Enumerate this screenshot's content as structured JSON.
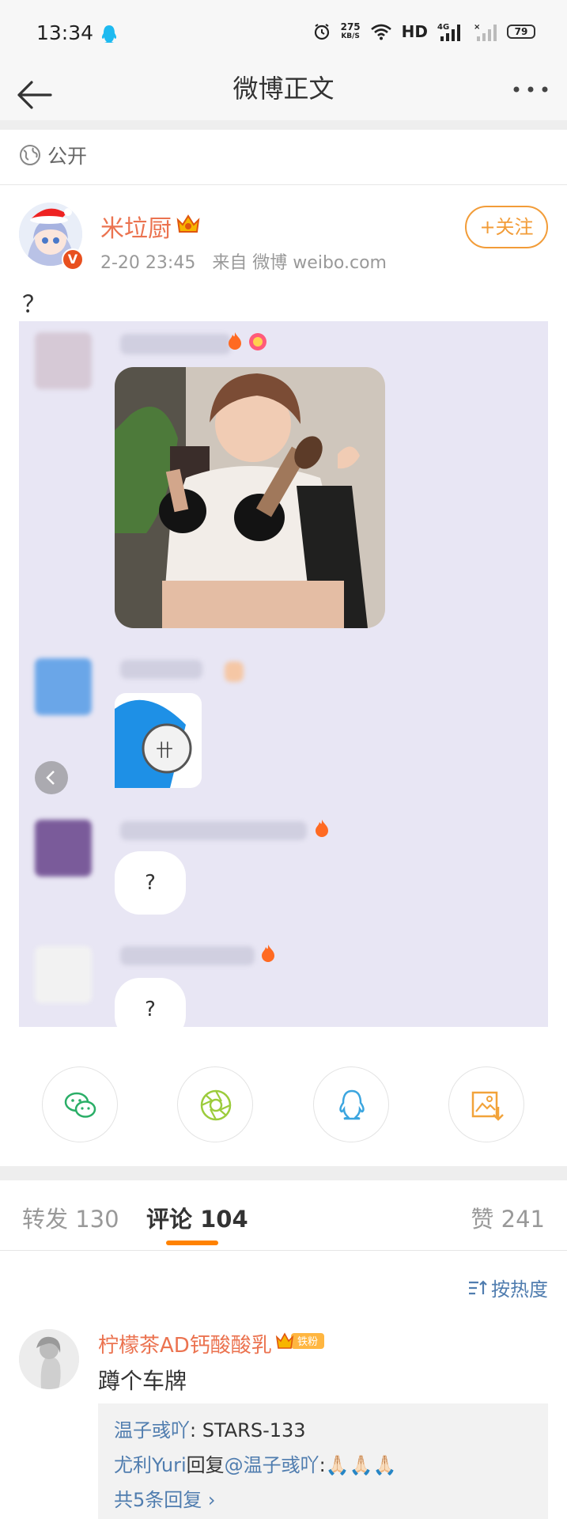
{
  "status_bar": {
    "time": "13:34",
    "net_speed_value": "275",
    "net_speed_unit": "KB/S",
    "hd": "HD",
    "network": "4G",
    "battery": "79"
  },
  "nav": {
    "title": "微博正文"
  },
  "post": {
    "visibility": "公开",
    "author": "米垃厨",
    "time": "2-20 23:45",
    "source": "来自 微博 weibo.com",
    "follow_label": "+关注",
    "text": "？",
    "image": {
      "bubble_text_1": "?",
      "bubble_text_2": "?"
    }
  },
  "share": [
    {
      "name": "wechat-icon",
      "color": "#2aae67"
    },
    {
      "name": "moments-icon",
      "color": "#9ccc3c"
    },
    {
      "name": "qq-icon",
      "color": "#3ba5df"
    },
    {
      "name": "save-image-icon",
      "color": "#f2a33a"
    }
  ],
  "tabs": {
    "repost": "转发 130",
    "comment": "评论 104",
    "like": "赞 241"
  },
  "sort": {
    "label": "按热度"
  },
  "comment": {
    "author": "柠檬茶AD钙酸酸乳",
    "badge": "铁粉",
    "text": "蹲个车牌",
    "replies": {
      "r1_name": "温子彧吖",
      "r1_text": ": STARS-133",
      "r2_name": "尤利Yuri",
      "r2_mid": "回复",
      "r2_target": "@温子彧吖",
      "r2_text": ":🙏🏻🙏🏻🙏🏻",
      "more": "共5条回复 ›"
    }
  }
}
